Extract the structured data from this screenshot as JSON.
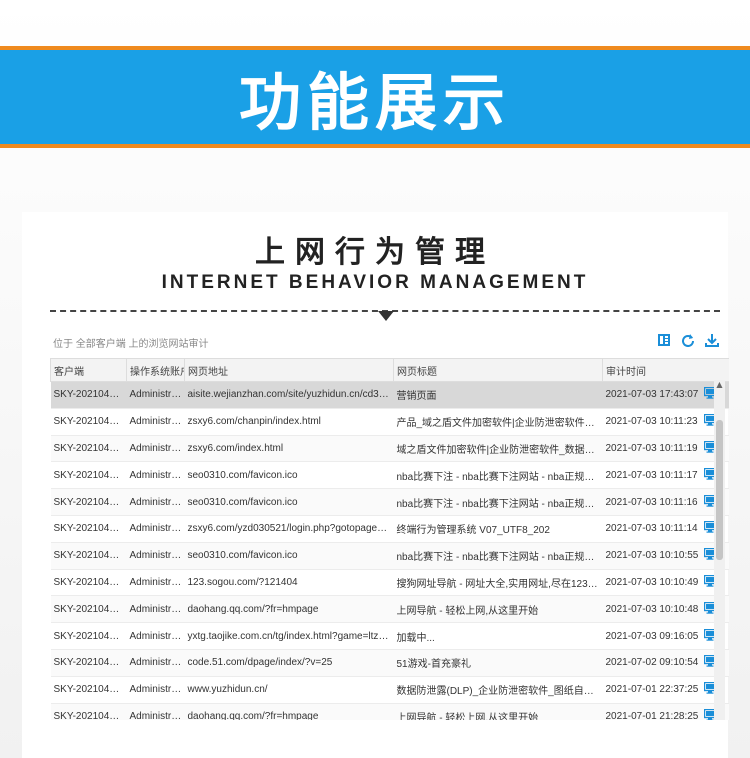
{
  "banner": {
    "title": "功能展示"
  },
  "card": {
    "title": "上网行为管理",
    "subtitle": "INTERNET BEHAVIOR MANAGEMENT",
    "breadcrumb": "位于 全部客户端 上的浏览网站审计",
    "toolbar": {
      "icons": [
        "columns-icon",
        "refresh-icon",
        "download-icon"
      ]
    }
  },
  "colors": {
    "banner_blue": "#1aa0e6",
    "banner_border": "#ef8a1e",
    "icon_blue": "#1a8ed8"
  },
  "table": {
    "columns": [
      "客户端",
      "操作系统账户",
      "网页地址",
      "网页标题",
      "审计时间"
    ],
    "rows": [
      {
        "client": "SKY-20210427J...",
        "account": "Administra...",
        "url": "aisite.wejianzhan.com/site/yuzhidun.cn/cd330...",
        "title": "营销页面",
        "time": "2021-07-03 17:43:07"
      },
      {
        "client": "SKY-20210427J...",
        "account": "Administra...",
        "url": "zsxy6.com/chanpin/index.html",
        "title": "产品_域之盾文件加密软件|企业防泄密软件_数据防...",
        "time": "2021-07-03 10:11:23"
      },
      {
        "client": "SKY-20210427J...",
        "account": "Administra...",
        "url": "zsxy6.com/index.html",
        "title": "域之盾文件加密软件|企业防泄密软件_数据防泄露(...",
        "time": "2021-07-03 10:11:19"
      },
      {
        "client": "SKY-20210427J...",
        "account": "Administra...",
        "url": "seo0310.com/favicon.ico",
        "title": "nba比赛下注 - nba比赛下注网站 - nba正规比赛下...",
        "time": "2021-07-03 10:11:17"
      },
      {
        "client": "SKY-20210427J...",
        "account": "Administra...",
        "url": "seo0310.com/favicon.ico",
        "title": "nba比赛下注 - nba比赛下注网站 - nba正规比赛下...",
        "time": "2021-07-03 10:11:16"
      },
      {
        "client": "SKY-20210427J...",
        "account": "Administra...",
        "url": "zsxy6.com/yzd030521/login.php?gotopage=...",
        "title": "终端行为管理系统 V07_UTF8_202",
        "time": "2021-07-03 10:11:14"
      },
      {
        "client": "SKY-20210427J...",
        "account": "Administra...",
        "url": "seo0310.com/favicon.ico",
        "title": "nba比赛下注 - nba比赛下注网站 - nba正规比赛下...",
        "time": "2021-07-03 10:10:55"
      },
      {
        "client": "SKY-20210427J...",
        "account": "Administra...",
        "url": "123.sogou.com/?121404",
        "title": "搜狗网址导航 - 网址大全,实用网址,尽在123.sog...",
        "time": "2021-07-03 10:10:49"
      },
      {
        "client": "SKY-20210427J...",
        "account": "Administra...",
        "url": "daohang.qq.com/?fr=hmpage",
        "title": "上网导航 - 轻松上网,从这里开始",
        "time": "2021-07-03 10:10:48"
      },
      {
        "client": "SKY-20210427J...",
        "account": "Administra...",
        "url": "yxtg.taojike.com.cn/tg/index.html?game=ltzn...",
        "title": "加载中...",
        "time": "2021-07-03 09:16:05"
      },
      {
        "client": "SKY-20210427J...",
        "account": "Administra...",
        "url": "code.51.com/dpage/index/?v=25",
        "title": "51游戏-首充豪礼",
        "time": "2021-07-02 09:10:54"
      },
      {
        "client": "SKY-20210427J...",
        "account": "Administra...",
        "url": "www.yuzhidun.cn/",
        "title": "数据防泄露(DLP)_企业防泄密软件_图纸自动加密软...",
        "time": "2021-07-01 22:37:25"
      },
      {
        "client": "SKY-20210427J...",
        "account": "Administra...",
        "url": "daohang.qq.com/?fr=hmpage",
        "title": "上网导航 - 轻松上网,从这里开始",
        "time": "2021-07-01 21:28:25"
      }
    ]
  }
}
